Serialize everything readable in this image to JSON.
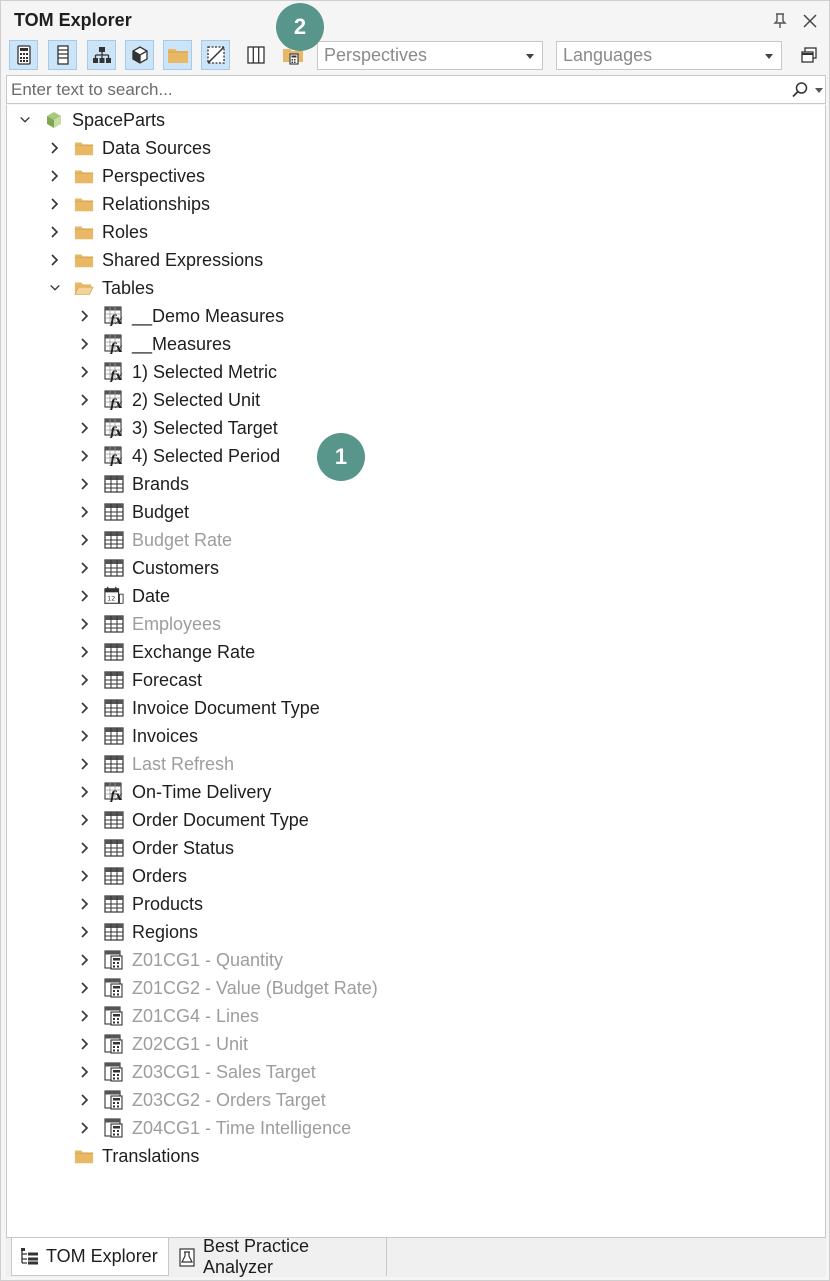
{
  "window": {
    "title": "TOM Explorer"
  },
  "toolbar": {
    "perspectives_placeholder": "Perspectives",
    "languages_placeholder": "Languages"
  },
  "search": {
    "placeholder": "Enter text to search..."
  },
  "badges": {
    "one": "1",
    "two": "2"
  },
  "tree": {
    "root": "SpaceParts",
    "folders": [
      {
        "label": "Data Sources"
      },
      {
        "label": "Perspectives"
      },
      {
        "label": "Relationships"
      },
      {
        "label": "Roles"
      },
      {
        "label": "Shared Expressions"
      }
    ],
    "tables_label": "Tables",
    "tables": [
      {
        "label": "__Demo Measures",
        "icon": "measure-table-icon",
        "dim": false
      },
      {
        "label": "__Measures",
        "icon": "measure-table-icon",
        "dim": false
      },
      {
        "label": "1) Selected Metric",
        "icon": "measure-table-icon",
        "dim": false
      },
      {
        "label": "2) Selected Unit",
        "icon": "measure-table-icon",
        "dim": false
      },
      {
        "label": "3) Selected Target",
        "icon": "measure-table-icon",
        "dim": false
      },
      {
        "label": "4) Selected Period",
        "icon": "measure-table-icon",
        "dim": false
      },
      {
        "label": "Brands",
        "icon": "table-icon",
        "dim": false
      },
      {
        "label": "Budget",
        "icon": "table-icon",
        "dim": false
      },
      {
        "label": "Budget Rate",
        "icon": "table-icon",
        "dim": true
      },
      {
        "label": "Customers",
        "icon": "table-icon",
        "dim": false
      },
      {
        "label": "Date",
        "icon": "date-table-icon",
        "dim": false
      },
      {
        "label": "Employees",
        "icon": "table-icon",
        "dim": true
      },
      {
        "label": "Exchange Rate",
        "icon": "table-icon",
        "dim": false
      },
      {
        "label": "Forecast",
        "icon": "table-icon",
        "dim": false
      },
      {
        "label": "Invoice Document Type",
        "icon": "table-icon",
        "dim": false
      },
      {
        "label": "Invoices",
        "icon": "table-icon",
        "dim": false
      },
      {
        "label": "Last Refresh",
        "icon": "table-icon",
        "dim": true
      },
      {
        "label": "On-Time Delivery",
        "icon": "measure-table-icon",
        "dim": false
      },
      {
        "label": "Order Document Type",
        "icon": "table-icon",
        "dim": false
      },
      {
        "label": "Order Status",
        "icon": "table-icon",
        "dim": false
      },
      {
        "label": "Orders",
        "icon": "table-icon",
        "dim": false
      },
      {
        "label": "Products",
        "icon": "table-icon",
        "dim": false
      },
      {
        "label": "Regions",
        "icon": "table-icon",
        "dim": false
      },
      {
        "label": "Z01CG1 - Quantity",
        "icon": "calculation-group-icon",
        "dim": true
      },
      {
        "label": "Z01CG2 - Value (Budget Rate)",
        "icon": "calculation-group-icon",
        "dim": true
      },
      {
        "label": "Z01CG4 - Lines",
        "icon": "calculation-group-icon",
        "dim": true
      },
      {
        "label": "Z02CG1 - Unit",
        "icon": "calculation-group-icon",
        "dim": true
      },
      {
        "label": "Z03CG1 - Sales Target",
        "icon": "calculation-group-icon",
        "dim": true
      },
      {
        "label": "Z03CG2 - Orders Target",
        "icon": "calculation-group-icon",
        "dim": true
      },
      {
        "label": "Z04CG1 - Time Intelligence",
        "icon": "calculation-group-icon",
        "dim": true
      }
    ],
    "translations_label": "Translations"
  },
  "bottom_tabs": [
    {
      "label": "TOM Explorer",
      "active": true
    },
    {
      "label": "Best Practice Analyzer",
      "active": false
    }
  ],
  "colors": {
    "badge": "#58958a",
    "folder": "#e8b867",
    "accent": "#cce4f7",
    "dim_text": "#9d9d9d"
  }
}
